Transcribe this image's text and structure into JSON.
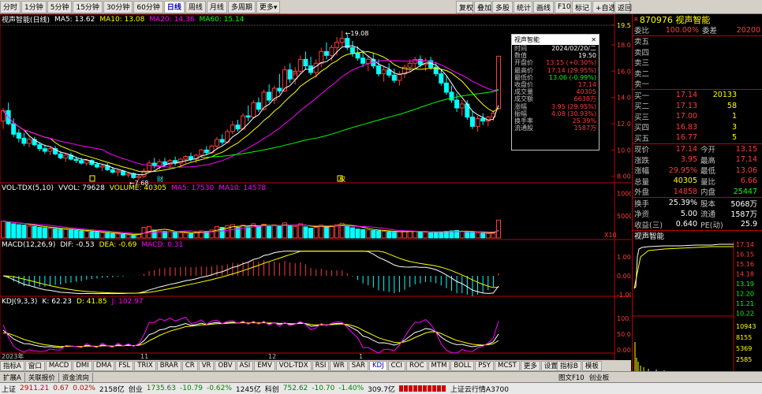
{
  "toolbar": {
    "period_buttons": [
      "分时",
      "1分钟",
      "5分钟",
      "15分钟",
      "30分钟",
      "60分钟",
      "日线",
      "周线",
      "月线",
      "多周期",
      "更多▾"
    ],
    "right_buttons": [
      "复权",
      "叠加",
      "多股",
      "统计",
      "画线",
      "F10",
      "标记",
      "+自选",
      "返回"
    ]
  },
  "main_header": {
    "title": "视声智能(日线)",
    "ma5": "MA5: 13.62",
    "ma10": "MA10: 13.08",
    "ma20": "MA20: 14.36",
    "ma60": "MA60: 15.14"
  },
  "vol_header": {
    "title": "VOL-TDX(5,10)",
    "vvol": "VVOL: 79628",
    "volume": "VOLUME: 40305",
    "ma5": "MA5: 17530",
    "ma10": "MA10: 14578"
  },
  "macd_header": {
    "title": "MACD(12,26,9)",
    "dif": "DIF: -0.53",
    "dea": "DEA: -0.69",
    "macd": "MACD: 0.31"
  },
  "kdj_header": {
    "title": "KDJ(9,3,3)",
    "k": "K: 62.23",
    "d": "D: 41.85",
    "j": "J: 102.97"
  },
  "price_axis": [
    "19.50",
    "18.00",
    "16.00",
    "14.00",
    "12.00",
    "10.00",
    "8.00"
  ],
  "vol_axis": [
    "10000",
    "5000",
    "X10"
  ],
  "macd_axis": [
    "1.00",
    "0.00",
    "-1.00"
  ],
  "kdj_axis": [
    "100.00",
    "50.00",
    "0.00"
  ],
  "annotations": {
    "high_label": "19.08",
    "low_label": "7.68",
    "tag_a": "财",
    "tag_b": "权",
    "tag_c": "R"
  },
  "x_labels": [
    "2023年",
    "11",
    "12",
    "1"
  ],
  "tooltip": {
    "title": "视声智能",
    "rows": [
      {
        "k": "时间",
        "v": "2024/02/20/二"
      },
      {
        "k": "数值",
        "v": "19.50"
      },
      {
        "k": "开盘价",
        "v": "13.15 (+0.30%)"
      },
      {
        "k": "最高价",
        "v": "17.14 (29.95%)"
      },
      {
        "k": "最低价",
        "v": "13.06 (-0.99%)"
      },
      {
        "k": "收盘价",
        "v": "17.14"
      },
      {
        "k": "成交量",
        "v": "40305"
      },
      {
        "k": "成交额",
        "v": "6638万"
      },
      {
        "k": "涨幅",
        "v": "3.95 (29.95%)"
      },
      {
        "k": "振幅",
        "v": "4.08 (30.93%)"
      },
      {
        "k": "换手率",
        "v": "25.39%"
      },
      {
        "k": "流通股",
        "v": "1587万"
      }
    ]
  },
  "stock": {
    "code": "870976",
    "name": "视声智能",
    "weibi_label": "委比",
    "weibi": "100.00%",
    "weicha_label": "委差",
    "weicha": "20200",
    "asks": [
      {
        "label": "卖五",
        "price": "",
        "vol": ""
      },
      {
        "label": "卖四",
        "price": "",
        "vol": ""
      },
      {
        "label": "卖三",
        "price": "",
        "vol": ""
      },
      {
        "label": "卖二",
        "price": "",
        "vol": ""
      },
      {
        "label": "卖一",
        "price": "",
        "vol": ""
      }
    ],
    "bids": [
      {
        "label": "买一",
        "price": "17.14",
        "vol": "20133"
      },
      {
        "label": "买二",
        "price": "17.13",
        "vol": "58"
      },
      {
        "label": "买三",
        "price": "17.00",
        "vol": "1"
      },
      {
        "label": "买四",
        "price": "16.83",
        "vol": "3"
      },
      {
        "label": "买五",
        "price": "16.77",
        "vol": "5"
      }
    ],
    "quote": [
      {
        "l1": "现价",
        "v1": "17.14",
        "l2": "今开",
        "v2": "13.15"
      },
      {
        "l1": "涨跌",
        "v1": "3.95",
        "l2": "最高",
        "v2": "17.14"
      },
      {
        "l1": "涨幅",
        "v1": "29.95%",
        "l2": "最低",
        "v2": "13.06"
      },
      {
        "l1": "总量",
        "v1": "40305",
        "l2": "量比",
        "v2": "6.66"
      },
      {
        "l1": "外盘",
        "v1": "14858",
        "l2": "内盘",
        "v2": "25447"
      }
    ],
    "stats": [
      {
        "l1": "换手",
        "v1": "25.39%",
        "l2": "股本",
        "v2": "5068万"
      },
      {
        "l1": "净资",
        "v1": "5.00",
        "l2": "流通",
        "v2": "1587万"
      },
      {
        "l1": "收益(三)",
        "v1": "0.640",
        "l2": "PE(动)",
        "v2": "25.9"
      }
    ],
    "mini_title": "视声智能",
    "mini_price_axis": [
      "17.14",
      "16.15",
      "15.16",
      "14.18",
      "13.19",
      "12.20",
      "11.21",
      "10.22"
    ],
    "mini_vol_axis": [
      "10943",
      "8155",
      "5369",
      "2585"
    ],
    "mini_footer_left": "日线",
    "mini_tabs": [
      "笔",
      "分",
      "价",
      "势",
      "联",
      "值",
      "主",
      "筹"
    ]
  },
  "indicator_tabs": [
    "指标A",
    "窗口",
    "MACD",
    "DMI",
    "DMA",
    "FSL",
    "TRIX",
    "BRAR",
    "CR",
    "VR",
    "OBV",
    "ASI",
    "EMV",
    "VOL-TDX",
    "RSI",
    "WR",
    "SAR",
    "KDJ",
    "CCI",
    "ROC",
    "MTM",
    "BOLL",
    "PSY",
    "MCST",
    "更多",
    "设置"
  ],
  "indicator_right": [
    "指标B",
    "模板"
  ],
  "bottom_tabs": [
    "扩展A",
    "关联报价",
    "资金流向"
  ],
  "bottom_right": [
    "图文F10",
    "创业板"
  ],
  "status": {
    "sh_label": "上证",
    "sh_val": "2911.21",
    "sh_chg": "0.67",
    "sh_pct": "0.02%",
    "sh_amt": "2158亿",
    "cy_label": "创业",
    "cy_val": "1735.63",
    "cy_chg": "-10.79",
    "cy_pct": "-0.62%",
    "cy_amt": "1245亿",
    "kc_label": "科创",
    "kc_val": "752.62",
    "kc_chg": "-10.70",
    "kc_pct": "-1.40%",
    "kc_amt": "309.7亿",
    "feed": "上证云行情A3700"
  },
  "colors": {
    "up": "#ff3a3a",
    "down": "#00ffff",
    "ma5": "#ffffff",
    "ma10": "#ffff00",
    "ma20": "#ff00ff",
    "ma60": "#00ff00"
  },
  "chart_data": {
    "type": "candlestick",
    "title": "视声智能(日线)",
    "ylim": [
      7.5,
      19.5
    ],
    "candles": [
      [
        12.2,
        13.2,
        11.6,
        13.0
      ],
      [
        13.0,
        13.6,
        11.9,
        12.0
      ],
      [
        12.0,
        12.4,
        11.0,
        11.2
      ],
      [
        11.3,
        11.6,
        10.6,
        10.9
      ],
      [
        10.9,
        11.3,
        10.3,
        10.5
      ],
      [
        10.5,
        11.0,
        10.2,
        10.8
      ],
      [
        10.8,
        11.0,
        10.3,
        10.4
      ],
      [
        10.4,
        10.6,
        9.9,
        10.1
      ],
      [
        10.1,
        10.4,
        9.7,
        9.9
      ],
      [
        9.9,
        10.2,
        9.6,
        10.1
      ],
      [
        10.1,
        10.3,
        9.6,
        9.7
      ],
      [
        9.7,
        9.9,
        9.3,
        9.4
      ],
      [
        9.4,
        9.7,
        9.1,
        9.6
      ],
      [
        9.6,
        9.8,
        9.2,
        9.3
      ],
      [
        9.3,
        9.5,
        9.0,
        9.2
      ],
      [
        9.2,
        9.4,
        8.9,
        9.0
      ],
      [
        9.0,
        9.3,
        8.8,
        9.2
      ],
      [
        9.2,
        9.3,
        8.8,
        8.9
      ],
      [
        8.9,
        9.1,
        8.6,
        8.7
      ],
      [
        8.7,
        8.9,
        8.4,
        8.8
      ],
      [
        8.8,
        9.0,
        8.4,
        8.5
      ],
      [
        8.5,
        8.7,
        8.2,
        8.3
      ],
      [
        8.3,
        8.5,
        8.0,
        8.4
      ],
      [
        8.4,
        8.5,
        8.0,
        8.1
      ],
      [
        8.1,
        8.3,
        7.9,
        8.2
      ],
      [
        8.2,
        8.3,
        7.8,
        7.9
      ],
      [
        7.9,
        8.1,
        7.68,
        8.0
      ],
      [
        8.0,
        8.6,
        7.9,
        8.4
      ],
      [
        8.4,
        9.2,
        8.3,
        9.0
      ],
      [
        9.0,
        9.4,
        8.6,
        8.8
      ],
      [
        8.8,
        9.3,
        8.5,
        9.1
      ],
      [
        9.1,
        9.4,
        8.7,
        8.9
      ],
      [
        8.9,
        9.3,
        8.6,
        9.2
      ],
      [
        9.2,
        9.5,
        8.8,
        9.0
      ],
      [
        9.0,
        9.4,
        8.7,
        9.3
      ],
      [
        9.3,
        9.6,
        9.0,
        9.5
      ],
      [
        9.5,
        9.8,
        9.1,
        9.3
      ],
      [
        9.3,
        9.7,
        9.0,
        9.6
      ],
      [
        9.6,
        10.1,
        9.4,
        10.0
      ],
      [
        10.0,
        10.3,
        9.6,
        9.8
      ],
      [
        9.8,
        10.4,
        9.7,
        10.3
      ],
      [
        10.3,
        11.0,
        10.1,
        10.8
      ],
      [
        10.8,
        11.2,
        10.4,
        10.6
      ],
      [
        10.6,
        11.6,
        10.5,
        11.4
      ],
      [
        11.4,
        12.2,
        11.2,
        11.9
      ],
      [
        11.9,
        12.3,
        11.4,
        11.6
      ],
      [
        11.6,
        12.8,
        11.5,
        12.6
      ],
      [
        12.6,
        13.4,
        12.2,
        12.5
      ],
      [
        12.5,
        13.8,
        12.4,
        13.6
      ],
      [
        13.6,
        14.0,
        12.9,
        13.1
      ],
      [
        13.1,
        14.6,
        13.0,
        14.4
      ],
      [
        14.4,
        15.0,
        13.6,
        13.8
      ],
      [
        13.8,
        14.9,
        13.5,
        14.7
      ],
      [
        14.7,
        15.8,
        14.3,
        14.5
      ],
      [
        14.5,
        16.4,
        14.4,
        16.1
      ],
      [
        16.1,
        16.6,
        15.1,
        15.4
      ],
      [
        15.4,
        16.3,
        15.0,
        16.0
      ],
      [
        16.0,
        17.2,
        15.8,
        16.9
      ],
      [
        16.9,
        17.5,
        16.1,
        16.4
      ],
      [
        16.4,
        17.1,
        15.7,
        15.9
      ],
      [
        15.9,
        16.9,
        15.5,
        16.6
      ],
      [
        16.6,
        17.8,
        16.3,
        17.5
      ],
      [
        17.5,
        18.2,
        16.9,
        17.2
      ],
      [
        17.2,
        18.0,
        16.8,
        17.8
      ],
      [
        17.8,
        18.6,
        17.2,
        18.2
      ],
      [
        18.2,
        19.08,
        17.8,
        18.5
      ],
      [
        18.5,
        18.8,
        17.6,
        17.8
      ],
      [
        17.8,
        18.3,
        17.1,
        17.4
      ],
      [
        17.4,
        17.9,
        16.8,
        17.0
      ],
      [
        17.0,
        17.6,
        16.3,
        16.6
      ],
      [
        16.6,
        17.2,
        16.0,
        16.9
      ],
      [
        16.9,
        17.4,
        16.2,
        16.4
      ],
      [
        16.4,
        16.9,
        15.6,
        15.8
      ],
      [
        15.8,
        16.4,
        15.2,
        16.1
      ],
      [
        16.1,
        16.6,
        15.5,
        15.7
      ],
      [
        15.7,
        16.2,
        15.1,
        15.3
      ],
      [
        15.3,
        16.0,
        14.9,
        15.8
      ],
      [
        15.8,
        16.5,
        15.5,
        16.3
      ],
      [
        16.3,
        16.9,
        15.9,
        16.6
      ],
      [
        16.6,
        17.1,
        16.2,
        16.9
      ],
      [
        16.9,
        17.2,
        16.3,
        16.5
      ],
      [
        16.5,
        17.0,
        16.0,
        16.8
      ],
      [
        16.8,
        17.1,
        16.1,
        16.3
      ],
      [
        16.3,
        16.7,
        15.6,
        15.8
      ],
      [
        15.8,
        16.2,
        14.9,
        15.1
      ],
      [
        15.1,
        15.6,
        14.2,
        14.4
      ],
      [
        14.4,
        14.9,
        13.6,
        13.8
      ],
      [
        13.8,
        14.3,
        12.9,
        13.2
      ],
      [
        13.2,
        13.8,
        12.6,
        13.5
      ],
      [
        13.5,
        13.8,
        12.3,
        12.5
      ],
      [
        12.5,
        13.0,
        11.6,
        11.8
      ],
      [
        11.8,
        12.6,
        11.4,
        12.4
      ],
      [
        12.4,
        12.8,
        11.9,
        12.2
      ],
      [
        12.2,
        12.6,
        11.8,
        12.5
      ],
      [
        12.5,
        13.0,
        12.2,
        12.8
      ],
      [
        13.15,
        17.14,
        13.06,
        17.14
      ]
    ],
    "volume": [
      3800,
      3500,
      3200,
      3000,
      2900,
      2700,
      2600,
      2400,
      2300,
      2200,
      2100,
      2000,
      1900,
      1800,
      1700,
      1600,
      1500,
      1400,
      1300,
      1200,
      1100,
      1000,
      900,
      800,
      700,
      600,
      900,
      2400,
      2600,
      1800,
      1600,
      1500,
      1400,
      1300,
      1200,
      1100,
      1000,
      1300,
      1600,
      1500,
      1800,
      2600,
      2400,
      2800,
      3000,
      2400,
      2900,
      2500,
      3200,
      2700,
      3100,
      2600,
      2900,
      2700,
      3400,
      2800,
      2600,
      3200,
      2500,
      2200,
      2400,
      2900,
      2600,
      2800,
      3000,
      3300,
      2700,
      2300,
      2000,
      1900,
      1800,
      1700,
      1600,
      1500,
      1400,
      1300,
      1400,
      1500,
      1600,
      1500,
      1400,
      1300,
      1200,
      1300,
      1400,
      1500,
      1600,
      1700,
      1500,
      1400,
      1300,
      1200,
      1100,
      1000,
      1100,
      4030
    ],
    "macd_range": [
      -1.0,
      1.0
    ],
    "kdj_range": [
      0,
      100
    ]
  }
}
